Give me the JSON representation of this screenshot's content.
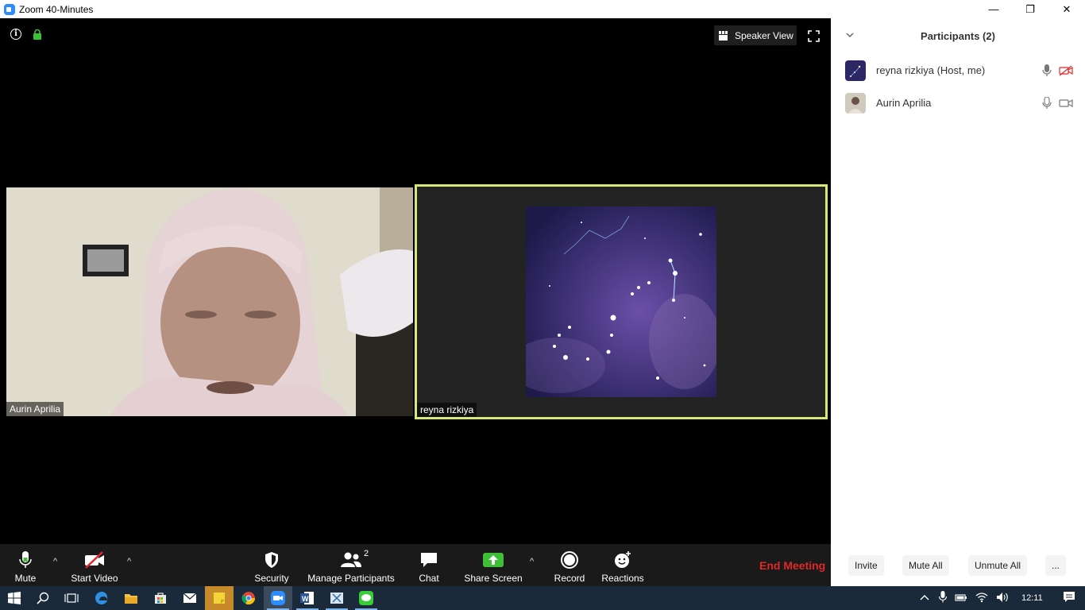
{
  "window": {
    "title": "Zoom 40-Minutes",
    "minimize_glyph": "—",
    "restore_glyph": "❐",
    "close_glyph": "✕"
  },
  "meeting": {
    "speaker_view_label": "Speaker View",
    "tiles": [
      {
        "name": "Aurin Aprilia"
      },
      {
        "name": "reyna rizkiya"
      }
    ],
    "active_speaker_border": "#d7e77a"
  },
  "toolbar": {
    "mute_label": "Mute",
    "start_video_label": "Start Video",
    "security_label": "Security",
    "manage_participants_label": "Manage Participants",
    "participants_count": "2",
    "chat_label": "Chat",
    "share_screen_label": "Share Screen",
    "record_label": "Record",
    "reactions_label": "Reactions",
    "end_meeting_label": "End Meeting",
    "caret_glyph": "^",
    "accent_share": "#3fbf38",
    "accent_end": "#e02828"
  },
  "panel": {
    "title": "Participants (2)",
    "participants": [
      {
        "name": "reyna rizkiya (Host, me)",
        "video_off": true
      },
      {
        "name": "Aurin Aprilia",
        "video_off": false
      }
    ],
    "invite_label": "Invite",
    "mute_all_label": "Mute All",
    "unmute_all_label": "Unmute All",
    "more_label": "..."
  },
  "taskbar": {
    "time": "12:11"
  }
}
